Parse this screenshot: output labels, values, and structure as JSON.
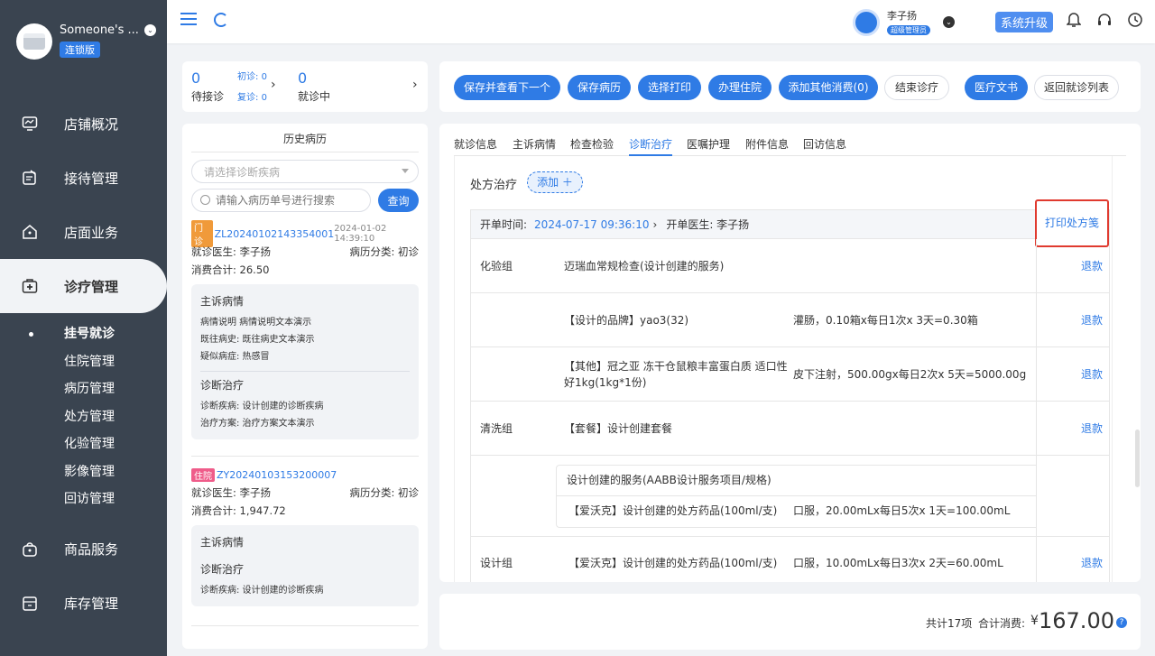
{
  "sidebar": {
    "store_name": "Someone's ...",
    "edition": "连锁版",
    "nav": [
      {
        "label": "店铺概况",
        "icon": "monitor-icon"
      },
      {
        "label": "接待管理",
        "icon": "clipboard-icon"
      },
      {
        "label": "店面业务",
        "icon": "home-icon"
      },
      {
        "label": "诊疗管理",
        "icon": "medical-kit-icon"
      },
      {
        "label": "商品服务",
        "icon": "bag-icon"
      },
      {
        "label": "库存管理",
        "icon": "inventory-icon"
      }
    ],
    "subnav": [
      "挂号就诊",
      "住院管理",
      "病历管理",
      "处方管理",
      "化验管理",
      "影像管理",
      "回访管理"
    ]
  },
  "topbar": {
    "user_name": "李子扬",
    "user_role": "超级管理员",
    "upgrade": "系统升级"
  },
  "waiting": {
    "wait_count": "0",
    "wait_label": "待接诊",
    "first_label": "初诊: ",
    "first_count": "0",
    "return_label": "复诊: ",
    "return_count": "0",
    "in_count": "0",
    "in_label": "就诊中"
  },
  "history": {
    "title": "历史病历",
    "select_placeholder": "请选择诊断疾病",
    "search_placeholder": "请输入病历单号进行搜索",
    "query_btn": "查询",
    "records": [
      {
        "tag": "门诊",
        "no": "ZL20240102143354001",
        "date": "2024-01-02 14:39:10",
        "doctor": "就诊医生: 李子扬",
        "category": "病历分类: 初诊",
        "total": "消费合计: 26.50",
        "complaint_title": "主诉病情",
        "complaint_lines": [
          "病情说明 病情说明文本演示",
          "既往病史: 既往病史文本演示",
          "疑似病症: 热感冒"
        ],
        "diag_title": "诊断治疗",
        "diag_lines": [
          "诊断疾病: 设计创建的诊断疾病",
          "治疗方案: 治疗方案文本演示"
        ]
      },
      {
        "tag": "住院",
        "no": "ZY20240103153200007",
        "doctor": "就诊医生: 李子扬",
        "category": "病历分类: 初诊",
        "total": "消费合计: 1,947.72",
        "complaint_title": "主诉病情",
        "diag_title": "诊断治疗",
        "diag_lines": [
          "诊断疾病: 设计创建的诊断疾病"
        ]
      }
    ]
  },
  "actions": [
    {
      "label": "保存并查看下一个",
      "style": "pri"
    },
    {
      "label": "保存病历",
      "style": "pri"
    },
    {
      "label": "选择打印",
      "style": "pri"
    },
    {
      "label": "办理住院",
      "style": "pri"
    },
    {
      "label": "添加其他消费(0)",
      "style": "pri"
    },
    {
      "label": "结束诊疗",
      "style": "def"
    },
    {
      "label": "医疗文书",
      "style": "pri"
    },
    {
      "label": "返回就诊列表",
      "style": "def"
    }
  ],
  "tabs": [
    "就诊信息",
    "主诉病情",
    "检查检验",
    "诊断治疗",
    "医嘱护理",
    "附件信息",
    "回访信息"
  ],
  "active_tab": "诊断治疗",
  "rx": {
    "title": "处方治疗",
    "add": "添加 ＋",
    "open_time_label": "开单时间:",
    "open_time": "2024-07-17 09:36:10",
    "doctor": "开单医生: 李子扬",
    "print": "打印处方笺",
    "refund": "退款",
    "rows": [
      {
        "group": "化验组",
        "item": "迈瑞血常规检查(设计创建的服务)",
        "usage": "",
        "refund": true
      },
      {
        "group": "",
        "item": "【设计的品牌】yao3(32)",
        "usage": "灌肠，0.10箱x每日1次x 3天=0.30箱",
        "refund": true
      },
      {
        "group": "",
        "item": "【其他】冠之亚 冻干仓鼠粮丰富蛋白质 适口性好1kg(1kg*1份)",
        "usage": "皮下注射，500.00gx每日2次x 5天=5000.00g",
        "refund": true
      },
      {
        "group": "清洗组",
        "item": "【套餐】设计创建套餐",
        "usage": "",
        "refund": true
      },
      {
        "group": "",
        "item": "设计创建的服务(AABB设计服务项目/规格)",
        "usage": "",
        "refund": false
      },
      {
        "group": "",
        "item": "【爱沃克】设计创建的处方药品(100ml/支)",
        "usage": "口服，20.00mLx每日5次x 1天=100.00mL",
        "refund": false
      },
      {
        "group": "设计组",
        "item": "【爱沃克】设计创建的处方药品(100ml/支)",
        "usage": "口服，10.00mLx每日3次x 2天=60.00mL",
        "refund": true
      }
    ]
  },
  "summary": {
    "count": "共计17项",
    "label": "合计消费:",
    "currency": "¥",
    "total": "167.00"
  }
}
